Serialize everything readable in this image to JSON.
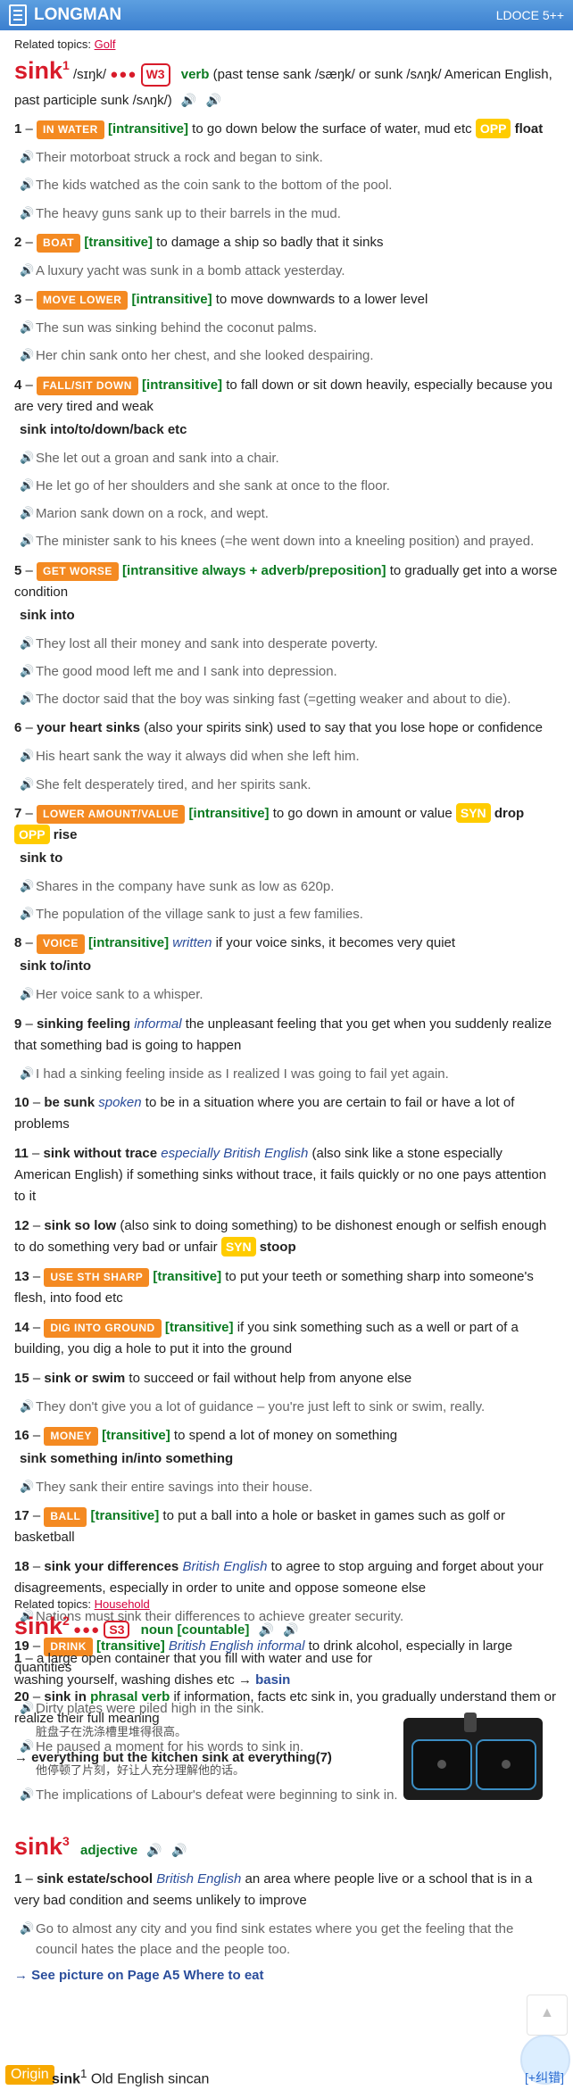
{
  "header": {
    "title": "LONGMAN",
    "edition": "LDOCE 5++"
  },
  "entry1": {
    "topics_label": "Related topics:",
    "topic": "Golf",
    "word": "sink",
    "sup": "1",
    "pron": "/sɪŋk/",
    "dots": "●●●",
    "freq": "W3",
    "pos": "verb",
    "forms": "(past tense sank /sæŋk/ or sunk /sʌŋk/ American English, past participle sunk /sʌŋk/)"
  },
  "senses": [
    {
      "num": "1",
      "sig": "IN WATER",
      "gram": "[intransitive]",
      "def": "to go down below the surface of water, mud etc",
      "opp": "OPP",
      "opp_word": "float",
      "ex": [
        "Their motorboat struck a rock and began to sink.",
        "The kids watched as the coin sank to the bottom of the pool.",
        "The heavy guns sank up to their barrels in the mud."
      ]
    },
    {
      "num": "2",
      "sig": "BOAT",
      "gram": "[transitive]",
      "def": "to damage a ship so badly that it sinks",
      "ex": [
        "A luxury yacht was sunk in a bomb attack yesterday."
      ]
    },
    {
      "num": "3",
      "sig": "MOVE LOWER",
      "gram": "[intransitive]",
      "def": "to move downwards to a lower level",
      "ex": [
        "The sun was sinking behind the coconut palms.",
        "Her chin sank onto her chest, and she looked despairing."
      ]
    },
    {
      "num": "4",
      "sig": "FALL/SIT DOWN",
      "gram": "[intransitive]",
      "def": "to fall down or sit down heavily, especially because you are very tired and weak",
      "colloc": "sink into/to/down/back etc",
      "ex": [
        "She let out a groan and sank into a chair.",
        "He let go of her shoulders and she sank at once to the floor.",
        "Marion sank down on a rock, and wept.",
        "The minister sank to his knees (=he went down into a kneeling position) and prayed."
      ]
    },
    {
      "num": "5",
      "sig": "GET WORSE",
      "gram": "[intransitive always + adverb/preposition]",
      "def": "to gradually get into a worse condition",
      "colloc": "sink into",
      "ex": [
        "They lost all their money and sank into desperate poverty.",
        "The good mood left me and I sank into depression.",
        "The doctor said that the boy was sinking fast (=getting weaker and about to die)."
      ]
    },
    {
      "num": "6",
      "lex": "your heart sinks",
      "def": "(also your spirits sink) used to say that you lose hope or confidence",
      "ex": [
        "His heart sank the way it always did when she left him.",
        "She felt desperately tired, and her spirits sank."
      ]
    },
    {
      "num": "7",
      "sig": "LOWER AMOUNT/VALUE",
      "gram": "[intransitive]",
      "def": "to go down in amount or value",
      "syn": "SYN",
      "syn_word": "drop",
      "opp": "OPP",
      "opp_word": "rise",
      "colloc": "sink to",
      "ex": [
        "Shares in the company have sunk as low as 620p.",
        "The population of the village sank to just a few families."
      ]
    },
    {
      "num": "8",
      "sig": "VOICE",
      "gram": "[intransitive]",
      "reg": "written",
      "def": "if your voice sinks, it becomes very quiet",
      "colloc": "sink to/into",
      "ex": [
        "Her voice sank to a whisper."
      ]
    },
    {
      "num": "9",
      "lex": "sinking feeling",
      "reg": "informal",
      "def": "the unpleasant feeling that you get when you suddenly realize that something bad is going to happen",
      "ex": [
        "I had a sinking feeling inside as I realized I was going to fail yet again."
      ]
    },
    {
      "num": "10",
      "lex": "be sunk",
      "reg": "spoken",
      "def": "to be in a situation where you are certain to fail or have a lot of problems"
    },
    {
      "num": "11",
      "lex": "sink without trace",
      "reg": "especially British English",
      "def": "(also sink like a stone especially American English) if something sinks without trace, it fails quickly or no one pays attention to it"
    },
    {
      "num": "12",
      "lex": "sink so low",
      "def": "(also sink to doing something) to be dishonest enough or selfish enough to do something very bad or unfair",
      "syn": "SYN",
      "syn_word": "stoop"
    },
    {
      "num": "13",
      "sig": "USE STH SHARP",
      "gram": "[transitive]",
      "def": "to put your teeth or something sharp into someone's flesh, into food etc"
    },
    {
      "num": "14",
      "sig": "DIG INTO GROUND",
      "gram": "[transitive]",
      "def": "if you sink something such as a well or part of a building, you dig a hole to put it into the ground"
    },
    {
      "num": "15",
      "lex": "sink or swim",
      "def": "to succeed or fail without help from anyone else",
      "ex": [
        "They don't give you a lot of guidance – you're just left to sink or swim, really."
      ]
    },
    {
      "num": "16",
      "sig": "MONEY",
      "gram": "[transitive]",
      "def": "to spend a lot of money on something",
      "colloc": "sink something in/into something",
      "ex": [
        "They sank their entire savings into their house."
      ]
    },
    {
      "num": "17",
      "sig": "BALL",
      "gram": "[transitive]",
      "def": "to put a ball into a hole or basket in games such as golf or basketball"
    },
    {
      "num": "18",
      "lex": "sink your differences",
      "reg": "British English",
      "def": "to agree to stop arguing and forget about your disagreements, especially in order to unite and oppose someone else",
      "ex": [
        "Nations must sink their differences to achieve greater security."
      ]
    },
    {
      "num": "19",
      "sig": "DRINK",
      "gram": "[transitive]",
      "reg": "British English informal",
      "def": "to drink alcohol, especially in large quantities"
    },
    {
      "num": "20",
      "lex": "sink in",
      "gram": "phrasal verb",
      "def": "if information, facts etc sink in, you gradually understand them or realize their full meaning",
      "ex": [
        "He paused a moment for his words to sink in.",
        "The implications of Labour's defeat were beginning to sink in."
      ],
      "zh": "他停顿了片刻，好让人充分理解他的话。"
    }
  ],
  "entry2": {
    "topics_label": "Related topics:",
    "topic": "Household",
    "word": "sink",
    "sup": "2",
    "dots": "●●●",
    "freq": "S3",
    "pos": "noun",
    "gram": "[countable]",
    "def_num": "1",
    "def": "a large open container that you fill with water and use for washing yourself, washing dishes etc →",
    "ref": "basin",
    "ex": "Dirty plates were piled high in the sink.",
    "zh": "脏盘子在洗涤槽里堆得很高。",
    "phrase": "→ everything but the kitchen sink at everything(7)"
  },
  "entry3": {
    "word": "sink",
    "sup": "3",
    "pos": "adjective",
    "def_num": "1",
    "lex": "sink estate/school",
    "reg": "British English",
    "def": "an area where people live or a school that is in a very bad condition and seems unlikely to improve",
    "ex": "Go to almost any city and you find sink estates where you get the feeling that the council hates the place and the people too.",
    "see": "→  See picture on Page A5 Where to eat"
  },
  "origin": {
    "label": "Origin",
    "word": "sink",
    "sup": "1",
    "text": "Old English sincan",
    "fix": "[+纠错]"
  },
  "colors": {
    "header": "#3b7fcf",
    "headword": "#d81b2a",
    "signpost": "#f48a22",
    "grammar": "#0a7a20",
    "opp": "#ffcc00"
  }
}
